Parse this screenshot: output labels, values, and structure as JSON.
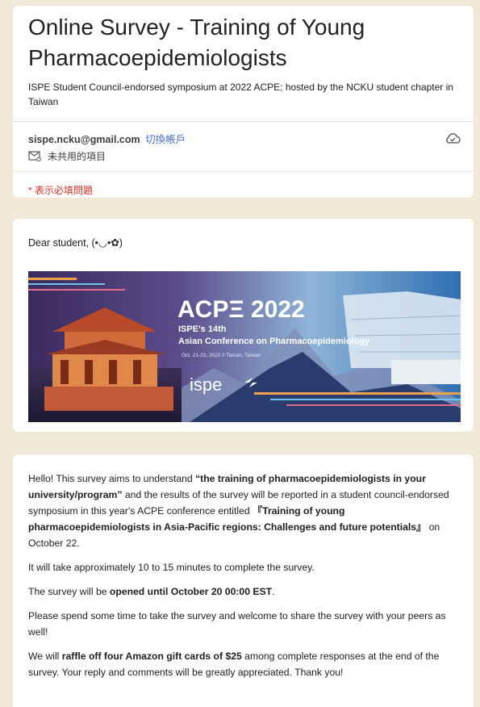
{
  "header": {
    "title": "Online Survey - Training of Young Pharmacoepidemiologists",
    "description": "ISPE Student Council-endorsed symposium at 2022 ACPE; hosted by the NCKU student chapter in Taiwan",
    "account_email": "sispe.ncku@gmail.com",
    "switch_account": "切換帳戶",
    "unshared_label": "未共用的項目",
    "required_note": "* 表示必填問題"
  },
  "greeting": {
    "text": "Dear student,   (•◡•✿)"
  },
  "banner": {
    "title": "ACPΞ 2022",
    "subtitle1": "ISPE's 14th",
    "subtitle2": "Asian Conference on Pharmacoepidemiology",
    "date_place": "Oct. 21-23, 2022  //  Tainan, Taiwan",
    "logo": "ispe"
  },
  "description": {
    "p1_a": "Hello! This survey aims to understand ",
    "p1_b": "“the training of pharmacoepidemiologists in your university/program”",
    "p1_c": " and the results of the survey will be reported in a student council-endorsed symposium in this year's ACPE conference entitled ",
    "p1_d": "『Training of young pharmacoepidemiologists in Asia-Pacific regions: Challenges and future potentials』",
    "p1_e": " on October 22.",
    "p2": "It will take approximately 10 to 15 minutes to complete the survey.",
    "p3_a": "The survey will be ",
    "p3_b": "opened until October 20 00:00 EST",
    "p3_c": ".",
    "p4": "Please spend some time to take the survey and welcome to share the survey with your peers as well!",
    "p5_a": "We will ",
    "p5_b": "raffle off four Amazon gift cards of $25",
    "p5_c": " among complete responses at the end of the survey. Your reply and comments will be greatly appreciated. Thank you!"
  },
  "colors": {
    "background": "#f2ead9",
    "link": "#4a6fc9",
    "required": "#d93025"
  }
}
